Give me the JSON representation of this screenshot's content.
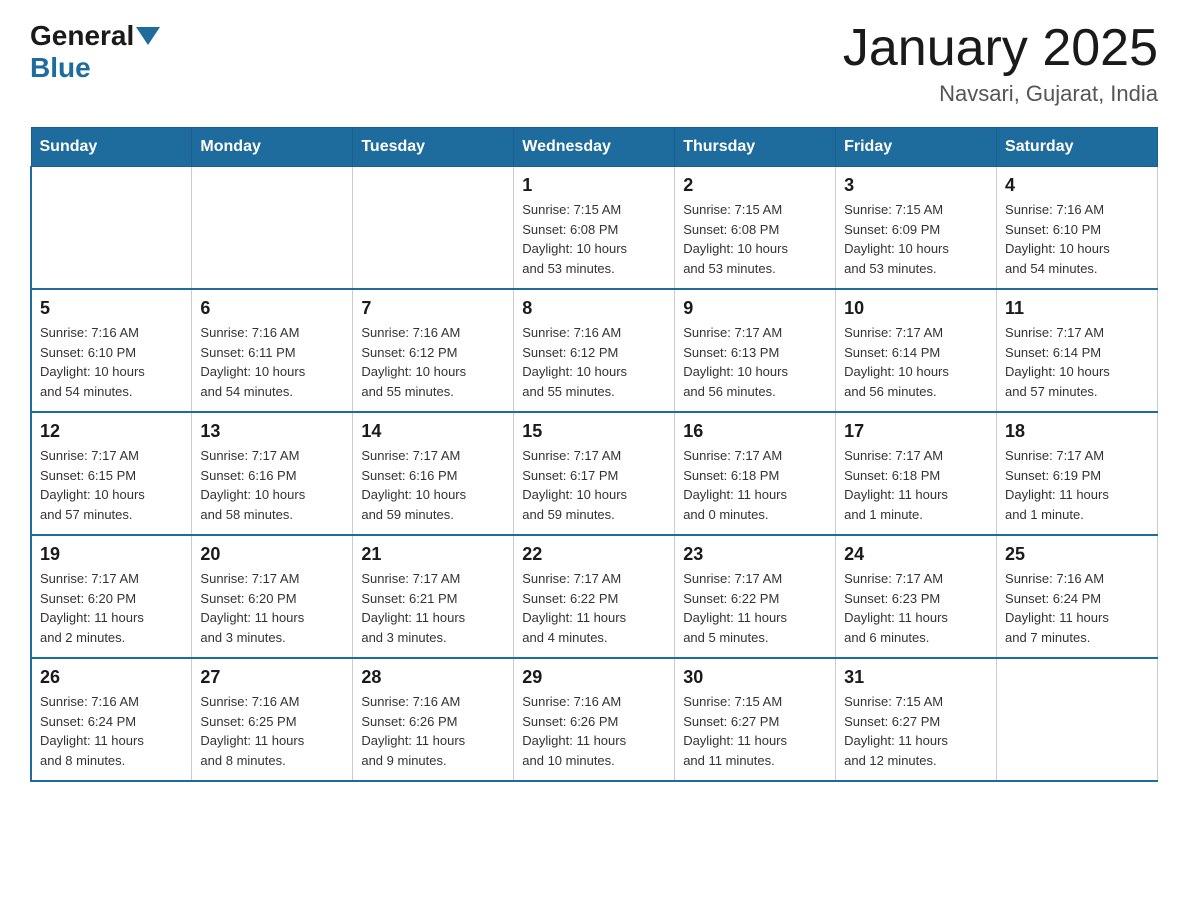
{
  "header": {
    "logo_general": "General",
    "logo_blue": "Blue",
    "month_title": "January 2025",
    "location": "Navsari, Gujarat, India"
  },
  "weekdays": [
    "Sunday",
    "Monday",
    "Tuesday",
    "Wednesday",
    "Thursday",
    "Friday",
    "Saturday"
  ],
  "weeks": [
    [
      {
        "day": "",
        "info": ""
      },
      {
        "day": "",
        "info": ""
      },
      {
        "day": "",
        "info": ""
      },
      {
        "day": "1",
        "info": "Sunrise: 7:15 AM\nSunset: 6:08 PM\nDaylight: 10 hours\nand 53 minutes."
      },
      {
        "day": "2",
        "info": "Sunrise: 7:15 AM\nSunset: 6:08 PM\nDaylight: 10 hours\nand 53 minutes."
      },
      {
        "day": "3",
        "info": "Sunrise: 7:15 AM\nSunset: 6:09 PM\nDaylight: 10 hours\nand 53 minutes."
      },
      {
        "day": "4",
        "info": "Sunrise: 7:16 AM\nSunset: 6:10 PM\nDaylight: 10 hours\nand 54 minutes."
      }
    ],
    [
      {
        "day": "5",
        "info": "Sunrise: 7:16 AM\nSunset: 6:10 PM\nDaylight: 10 hours\nand 54 minutes."
      },
      {
        "day": "6",
        "info": "Sunrise: 7:16 AM\nSunset: 6:11 PM\nDaylight: 10 hours\nand 54 minutes."
      },
      {
        "day": "7",
        "info": "Sunrise: 7:16 AM\nSunset: 6:12 PM\nDaylight: 10 hours\nand 55 minutes."
      },
      {
        "day": "8",
        "info": "Sunrise: 7:16 AM\nSunset: 6:12 PM\nDaylight: 10 hours\nand 55 minutes."
      },
      {
        "day": "9",
        "info": "Sunrise: 7:17 AM\nSunset: 6:13 PM\nDaylight: 10 hours\nand 56 minutes."
      },
      {
        "day": "10",
        "info": "Sunrise: 7:17 AM\nSunset: 6:14 PM\nDaylight: 10 hours\nand 56 minutes."
      },
      {
        "day": "11",
        "info": "Sunrise: 7:17 AM\nSunset: 6:14 PM\nDaylight: 10 hours\nand 57 minutes."
      }
    ],
    [
      {
        "day": "12",
        "info": "Sunrise: 7:17 AM\nSunset: 6:15 PM\nDaylight: 10 hours\nand 57 minutes."
      },
      {
        "day": "13",
        "info": "Sunrise: 7:17 AM\nSunset: 6:16 PM\nDaylight: 10 hours\nand 58 minutes."
      },
      {
        "day": "14",
        "info": "Sunrise: 7:17 AM\nSunset: 6:16 PM\nDaylight: 10 hours\nand 59 minutes."
      },
      {
        "day": "15",
        "info": "Sunrise: 7:17 AM\nSunset: 6:17 PM\nDaylight: 10 hours\nand 59 minutes."
      },
      {
        "day": "16",
        "info": "Sunrise: 7:17 AM\nSunset: 6:18 PM\nDaylight: 11 hours\nand 0 minutes."
      },
      {
        "day": "17",
        "info": "Sunrise: 7:17 AM\nSunset: 6:18 PM\nDaylight: 11 hours\nand 1 minute."
      },
      {
        "day": "18",
        "info": "Sunrise: 7:17 AM\nSunset: 6:19 PM\nDaylight: 11 hours\nand 1 minute."
      }
    ],
    [
      {
        "day": "19",
        "info": "Sunrise: 7:17 AM\nSunset: 6:20 PM\nDaylight: 11 hours\nand 2 minutes."
      },
      {
        "day": "20",
        "info": "Sunrise: 7:17 AM\nSunset: 6:20 PM\nDaylight: 11 hours\nand 3 minutes."
      },
      {
        "day": "21",
        "info": "Sunrise: 7:17 AM\nSunset: 6:21 PM\nDaylight: 11 hours\nand 3 minutes."
      },
      {
        "day": "22",
        "info": "Sunrise: 7:17 AM\nSunset: 6:22 PM\nDaylight: 11 hours\nand 4 minutes."
      },
      {
        "day": "23",
        "info": "Sunrise: 7:17 AM\nSunset: 6:22 PM\nDaylight: 11 hours\nand 5 minutes."
      },
      {
        "day": "24",
        "info": "Sunrise: 7:17 AM\nSunset: 6:23 PM\nDaylight: 11 hours\nand 6 minutes."
      },
      {
        "day": "25",
        "info": "Sunrise: 7:16 AM\nSunset: 6:24 PM\nDaylight: 11 hours\nand 7 minutes."
      }
    ],
    [
      {
        "day": "26",
        "info": "Sunrise: 7:16 AM\nSunset: 6:24 PM\nDaylight: 11 hours\nand 8 minutes."
      },
      {
        "day": "27",
        "info": "Sunrise: 7:16 AM\nSunset: 6:25 PM\nDaylight: 11 hours\nand 8 minutes."
      },
      {
        "day": "28",
        "info": "Sunrise: 7:16 AM\nSunset: 6:26 PM\nDaylight: 11 hours\nand 9 minutes."
      },
      {
        "day": "29",
        "info": "Sunrise: 7:16 AM\nSunset: 6:26 PM\nDaylight: 11 hours\nand 10 minutes."
      },
      {
        "day": "30",
        "info": "Sunrise: 7:15 AM\nSunset: 6:27 PM\nDaylight: 11 hours\nand 11 minutes."
      },
      {
        "day": "31",
        "info": "Sunrise: 7:15 AM\nSunset: 6:27 PM\nDaylight: 11 hours\nand 12 minutes."
      },
      {
        "day": "",
        "info": ""
      }
    ]
  ]
}
